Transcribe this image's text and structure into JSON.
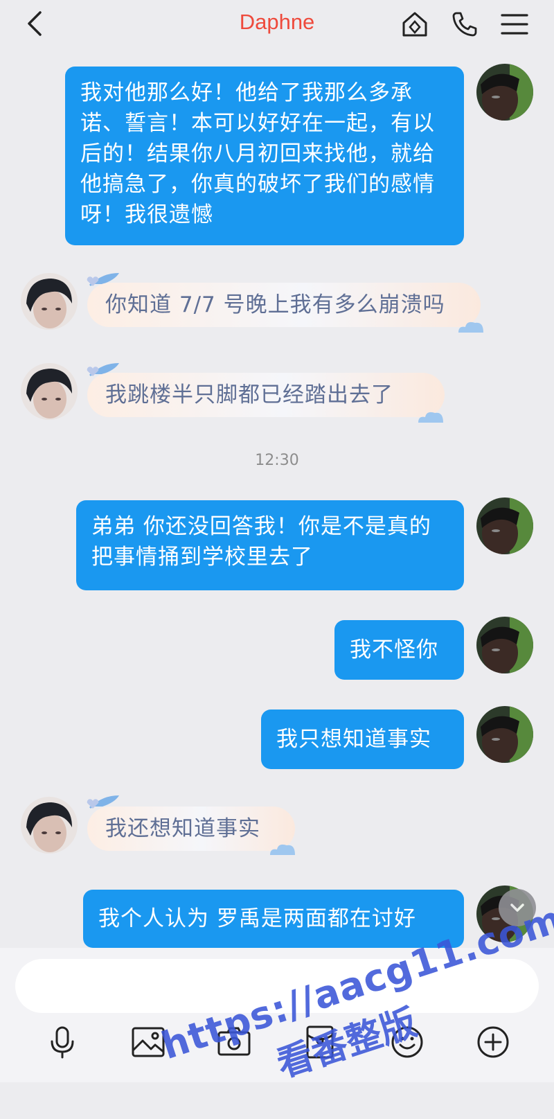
{
  "header": {
    "title": "Daphne",
    "icons": [
      "back-icon",
      "home-icon",
      "phone-icon",
      "menu-icon"
    ],
    "title_color": "#ee4a3c"
  },
  "messages": [
    {
      "side": "out",
      "text": "我对他那么好！他给了我那么多承诺、誓言！本可以好好在一起，有以后的！结果你八月初回来找他，就给他搞急了，你真的破坏了我们的感情呀！我很遗憾"
    },
    {
      "side": "in",
      "text": "你知道 7/7 号晚上我有多么崩溃吗"
    },
    {
      "side": "in",
      "text": "我跳楼半只脚都已经踏出去了"
    },
    {
      "side": "out",
      "text": "弟弟  你还没回答我！你是不是真的把事情捅到学校里去了"
    },
    {
      "side": "out",
      "text": "我不怪你"
    },
    {
      "side": "out",
      "text": "我只想知道事实"
    },
    {
      "side": "in",
      "text": "我还想知道事实"
    },
    {
      "side": "out",
      "text": "我个人认为 罗禹是两面都在讨好"
    }
  ],
  "timestamp": "12:30",
  "input": {
    "placeholder": ""
  },
  "toolbar": [
    "microphone-icon",
    "image-icon",
    "camera-icon",
    "red-packet-icon",
    "emoji-icon",
    "plus-icon"
  ],
  "watermark": {
    "url": "https://aacg11.com",
    "text": "看番整版"
  },
  "colors": {
    "outgoing_bubble": "#1a98f0",
    "incoming_text": "#5f6f95",
    "background": "#ececef"
  }
}
